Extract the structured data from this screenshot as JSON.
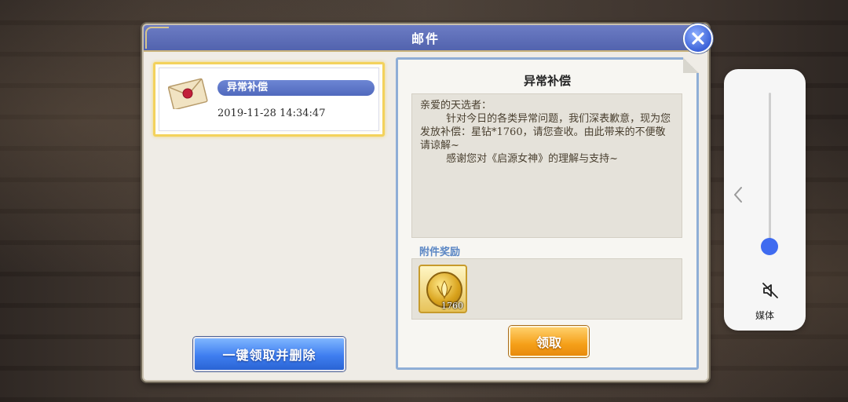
{
  "window": {
    "title": "邮件"
  },
  "mail_list": {
    "items": [
      {
        "subject": "异常补偿",
        "date": "2019-11-28  14:34:47",
        "selected": true
      }
    ],
    "delete_all_label": "一键领取并删除"
  },
  "detail": {
    "title": "异常补偿",
    "body": "亲爱的天选者：\n        针对今日的各类异常问题，我们深表歉意，现为您发放补偿：星钻*1760，请您查收。由此带来的不便敬请谅解~\n        感谢您对《启源女神》的理解与支持~",
    "attachment_label": "附件奖励",
    "rewards": [
      {
        "icon": "star-diamond-coin-icon",
        "quantity": "1760"
      }
    ],
    "claim_label": "领取"
  },
  "volume_overlay": {
    "label": "媒体",
    "level": 0.05,
    "muted": true
  },
  "colors": {
    "title_bar": "#5263ae",
    "selected_border": "#f3d25c",
    "claim_button": "#f5a019",
    "delete_button": "#3f7ef0",
    "volume_knob": "#3f6bf0"
  }
}
